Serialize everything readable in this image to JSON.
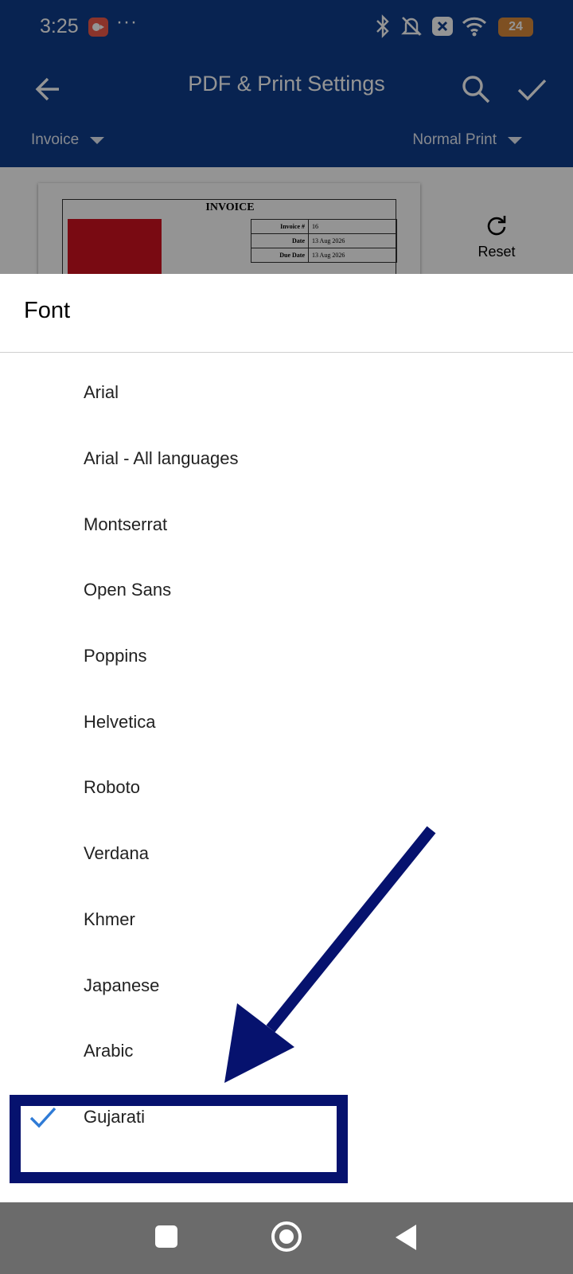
{
  "status_bar": {
    "time": "3:25",
    "dots": "···",
    "battery": "24",
    "icons": [
      "screen-record-icon",
      "bluetooth-icon",
      "muted-bell-icon",
      "close-box-icon",
      "wifi-icon",
      "battery-icon"
    ]
  },
  "toolbar": {
    "title": "PDF & Print Settings",
    "back_icon": "arrow-left-icon",
    "search_icon": "search-icon",
    "confirm_icon": "check-icon",
    "doc_type": "Invoice",
    "print_type": "Normal Print"
  },
  "preview": {
    "invoice_title": "INVOICE",
    "rows": [
      {
        "label": "Invoice #",
        "value": "16"
      },
      {
        "label": "Date",
        "value": "13 Aug 2026"
      },
      {
        "label": "Due Date",
        "value": "13 Aug 2026"
      }
    ],
    "reset_label": "Reset"
  },
  "font_sheet": {
    "title": "Font",
    "items": [
      {
        "label": "Arial"
      },
      {
        "label": "Arial - All languages"
      },
      {
        "label": "Montserrat"
      },
      {
        "label": "Open Sans"
      },
      {
        "label": "Poppins"
      },
      {
        "label": "Helvetica"
      },
      {
        "label": "Roboto"
      },
      {
        "label": "Verdana"
      },
      {
        "label": "Khmer"
      },
      {
        "label": "Japanese"
      },
      {
        "label": "Arabic"
      },
      {
        "label": "Gujarati"
      }
    ],
    "selected": "Gujarati"
  },
  "annotation": {
    "color": "#06126e"
  },
  "colors": {
    "appbar": "#0f3d8c",
    "check": "#2f7bd6",
    "navbar": "#6b6b6b"
  }
}
